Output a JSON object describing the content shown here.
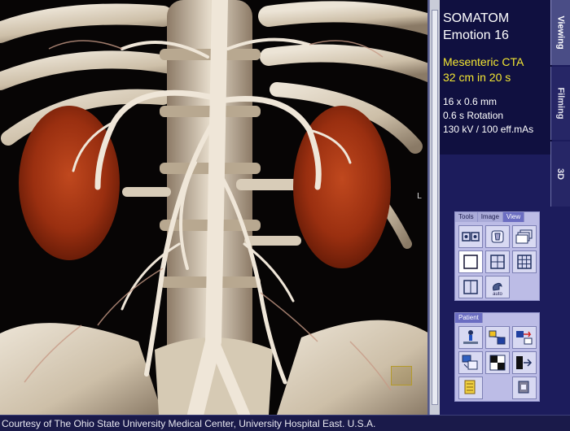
{
  "scanner": {
    "model_line1": "SOMATOM",
    "model_line2": "Emotion 16"
  },
  "protocol": {
    "name": "Mesenteric CTA",
    "coverage": "32 cm in 20 s"
  },
  "parameters": {
    "slices": "16 x 0.6 mm",
    "rotation": "0.6 s Rotation",
    "dose": "130 kV / 100 eff.mAs"
  },
  "viewport": {
    "orientation_marker": "L"
  },
  "vertical_tabs": {
    "viewing": "Viewing",
    "filming": "Filming",
    "threed": "3D"
  },
  "tool_card": {
    "tabs": [
      "Tools",
      "Image",
      "View"
    ],
    "active_tab": "View",
    "auto_caption": "auto",
    "buttons": [
      "layout-compare-icon",
      "volume-icon",
      "series-stack-icon",
      "single-view-icon",
      "quad-view-icon",
      "grid-3x3-icon",
      "two-column-icon",
      "auto-layout-icon"
    ]
  },
  "patient_card": {
    "tab": "Patient",
    "buttons": [
      "patient-position-icon",
      "scale-icon",
      "transfer-icon",
      "reconstruct-icon",
      "checker-icon",
      "series-forward-icon",
      "documents-icon",
      "empty",
      "printer-icon"
    ]
  },
  "footer": {
    "credit": "Courtesy of The Ohio State University Medical Center, University Hospital East. U.S.A."
  },
  "colors": {
    "panel_bg": "#1c1c5c",
    "info_bg": "#101040",
    "protocol_yellow": "#f3e632",
    "card_bg": "#bcbce6",
    "active_tab": "#6b6dc2"
  }
}
